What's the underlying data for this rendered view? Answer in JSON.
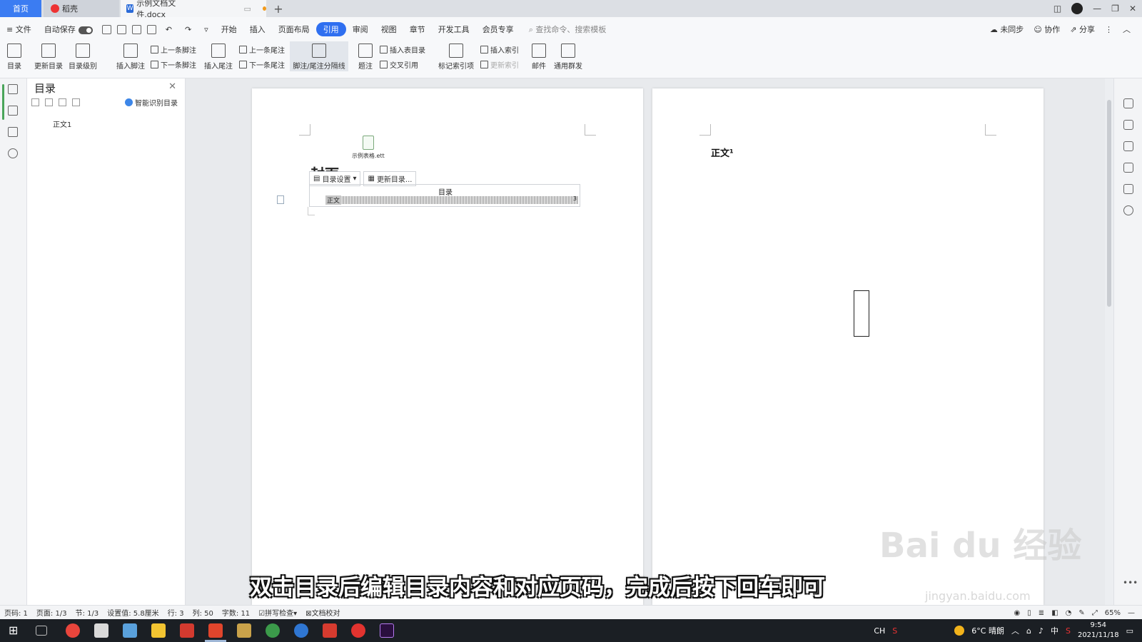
{
  "tabs": {
    "home": "首页",
    "daoke": "稻壳",
    "document": "示例文档文件.docx",
    "add": "+"
  },
  "menubar": {
    "file": "文件",
    "autosave": "自动保存",
    "items": [
      "开始",
      "插入",
      "页面布局",
      "引用",
      "审阅",
      "视图",
      "章节",
      "开发工具",
      "会员专享"
    ],
    "active_index": 3,
    "search_placeholder": "查找命令、搜索模板",
    "right": [
      "未同步",
      "协作",
      "分享"
    ]
  },
  "ribbon": {
    "toc": "目录",
    "update_toc": "更新目录",
    "toc_level": "目录级别",
    "insert_footnote": "插入脚注",
    "prev_footnote": "上一条脚注",
    "next_footnote": "下一条脚注",
    "insert_endnote": "插入尾注",
    "prev_endnote": "上一条尾注",
    "next_endnote": "下一条尾注",
    "separator": "脚注/尾注分隔线",
    "caption": "题注",
    "insert_table_toc": "插入表目录",
    "cross_ref": "交叉引用",
    "mark_index": "标记索引项",
    "insert_index": "插入索引",
    "update_index": "更新索引",
    "mail": "邮件",
    "group_send": "通用群发"
  },
  "toc_panel": {
    "title": "目录",
    "smart_identify": "智能识别目录",
    "entry": "正文1"
  },
  "document": {
    "attachment_name": "示例表格.ett",
    "cover_text": "封面",
    "toc_settings": "目录设置",
    "update_toc_btn": "更新目录...",
    "toc_heading": "目录",
    "toc_line_text": "正文",
    "toc_line_page": "3",
    "body_heading": "正文¹"
  },
  "subtitle": "双击目录后编辑目录内容和对应页码，完成后按下回车即可",
  "watermark": {
    "main": "Bai du 经验",
    "sub": "jingyan.baidu.com"
  },
  "statusbar": {
    "page_num": "页码: 1",
    "page": "页面: 1/3",
    "section": "节: 1/3",
    "setting": "设置值: 5.8厘米",
    "row": "行: 3",
    "col": "列: 50",
    "words": "字数: 11",
    "spell": "拼写检查",
    "proof": "文档校对",
    "zoom": "65%"
  },
  "taskbar": {
    "lang": "CH",
    "weather": "6°C 晴朗",
    "ime": "中",
    "time": "9:54",
    "date": "2021/11/18"
  },
  "colors": {
    "accent": "#2f6ff0",
    "home_tab": "#3b7cf2",
    "taskbar": "#1b1f24"
  }
}
